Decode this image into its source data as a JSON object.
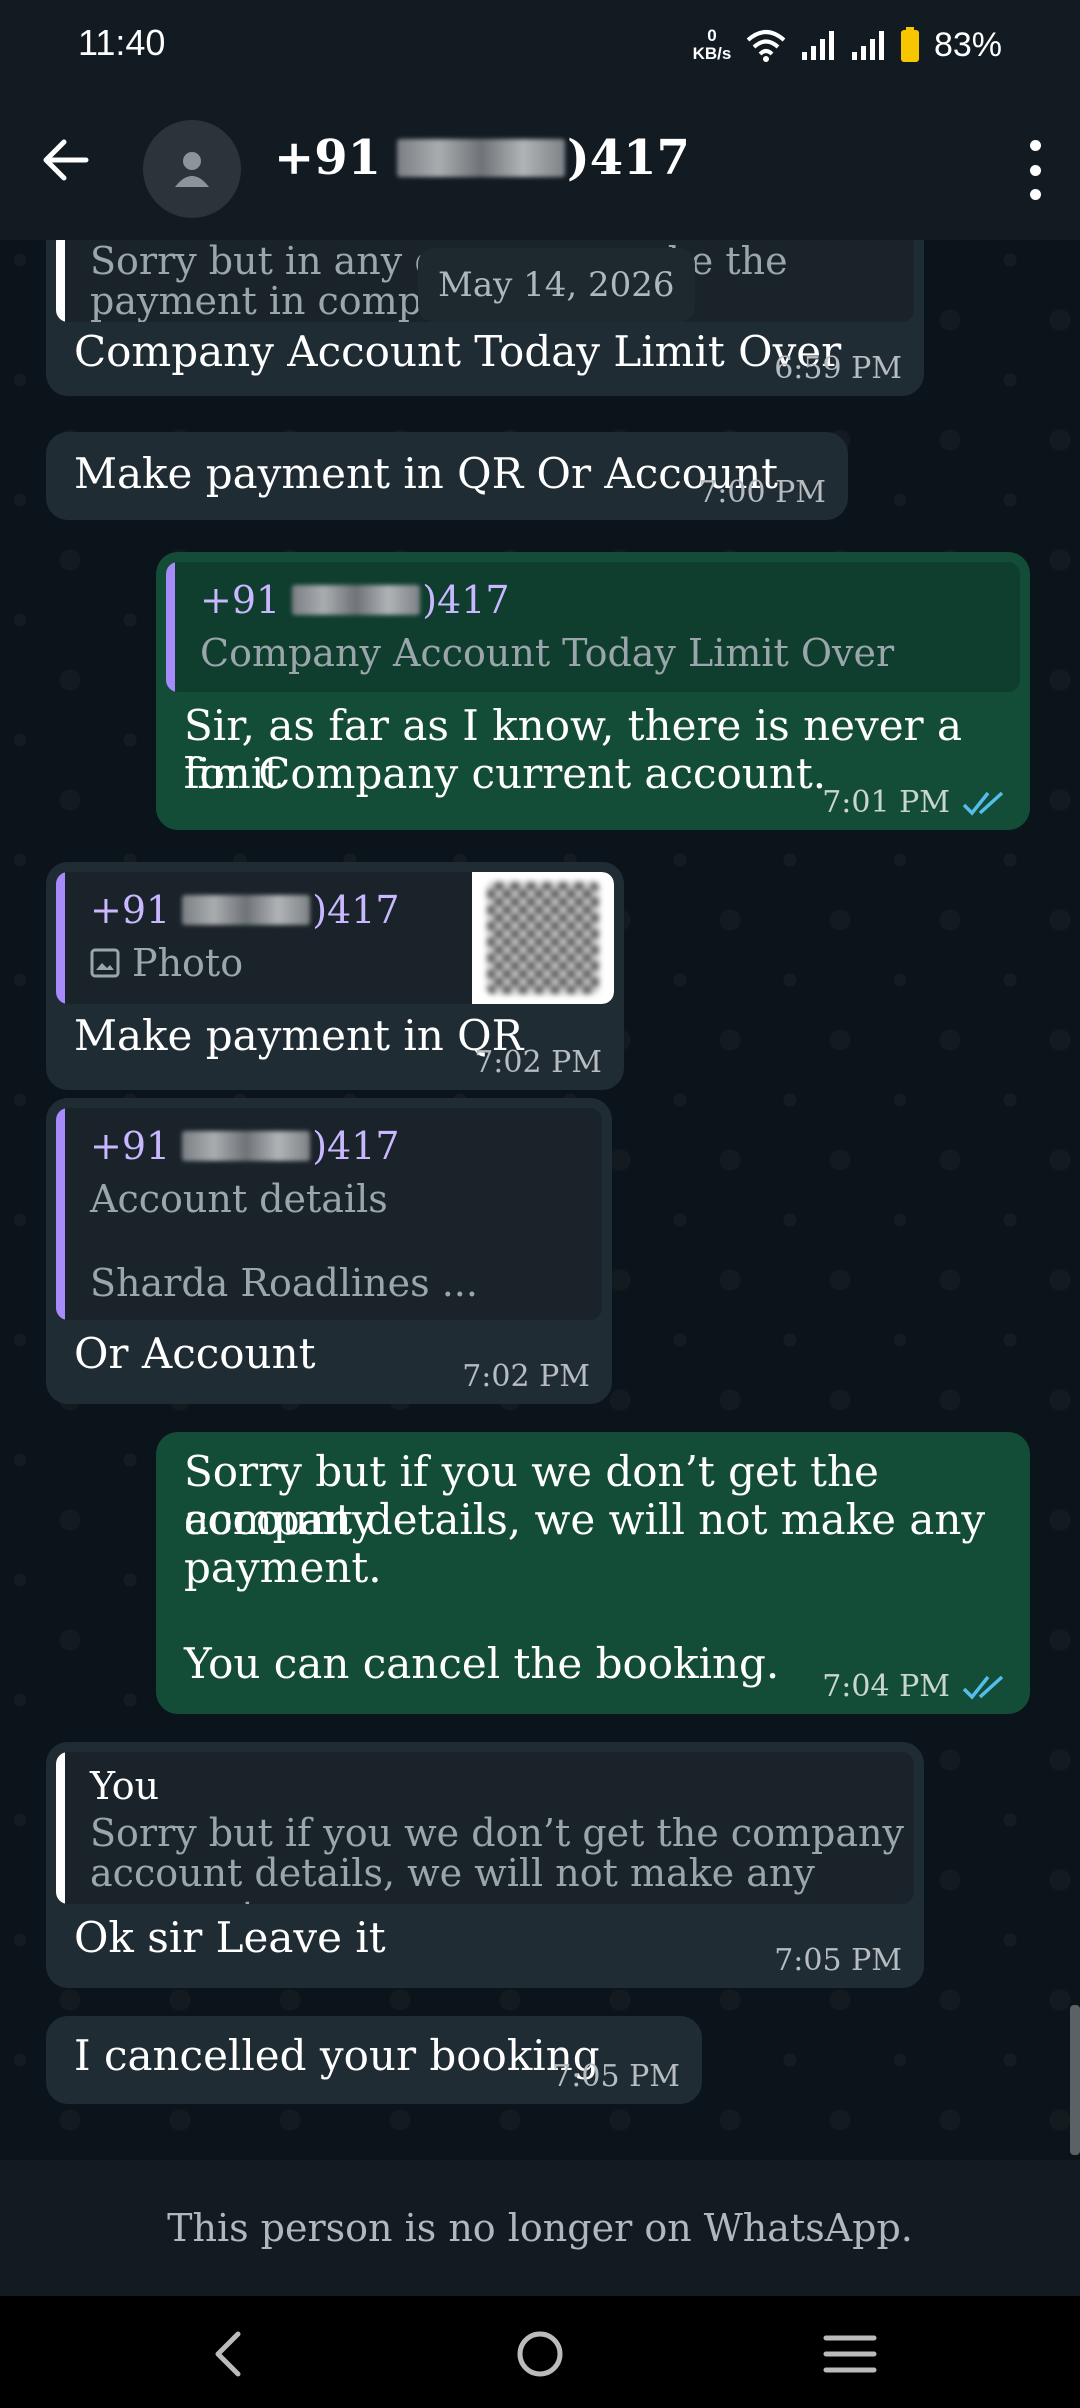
{
  "status_bar": {
    "time": "11:40",
    "net_speed_value": "0",
    "net_speed_unit": "KB/s",
    "battery": "83%"
  },
  "header": {
    "contact_prefix": "+91",
    "contact_suffix": ")417"
  },
  "date_chip": "May 14, 2026",
  "messages": [
    {
      "direction": "in",
      "quote_text_line1": "Sorry but in any cas",
      "quote_text_line1b": "ke the",
      "quote_text_line2": "payment in company",
      "text": "Company Account Today Limit Over",
      "time": "6:59 PM"
    },
    {
      "direction": "in",
      "text": "Make payment in QR Or Account",
      "time": "7:00 PM"
    },
    {
      "direction": "out",
      "quote_sender_prefix": "+91",
      "quote_sender_suffix": ")417",
      "quote_text": "Company Account Today Limit Over",
      "text_line1": "Sir, as far as I know, there is never a limit",
      "text_line2": "for Company current account.",
      "time": "7:01 PM"
    },
    {
      "direction": "in",
      "quote_sender_prefix": "+91",
      "quote_sender_suffix": ")417",
      "quote_text": "Photo",
      "text": "Make payment in QR",
      "time": "7:02 PM"
    },
    {
      "direction": "in",
      "quote_sender_prefix": "+91",
      "quote_sender_suffix": ")417",
      "quote_text_line1": "Account details",
      "quote_text_line2": "Sharda Roadlines ...",
      "text": "Or Account",
      "time": "7:02 PM"
    },
    {
      "direction": "out",
      "text_line1": "Sorry but if you we don’t get the company",
      "text_line2": "account details, we will not make any",
      "text_line3": "payment.",
      "text_line4": "You can cancel the booking.",
      "time": "7:04 PM"
    },
    {
      "direction": "in",
      "quote_sender": "You",
      "quote_text_line1": "Sorry but if you we don’t get the company",
      "quote_text_line2": "account details, we will not make any payment.",
      "quote_text_line3": "...",
      "text": "Ok sir Leave it",
      "time": "7:05 PM"
    },
    {
      "direction": "in",
      "text": "I cancelled your booking",
      "time": "7:05 PM"
    }
  ],
  "footer_notice": "This person is no longer on WhatsApp.",
  "colors": {
    "incoming_bubble": "#202c33",
    "outgoing_bubble": "#144d37",
    "read_ticks": "#53bdeb",
    "quote_bar_contact": "#a78bfa",
    "quote_bar_self": "#ffffff"
  }
}
